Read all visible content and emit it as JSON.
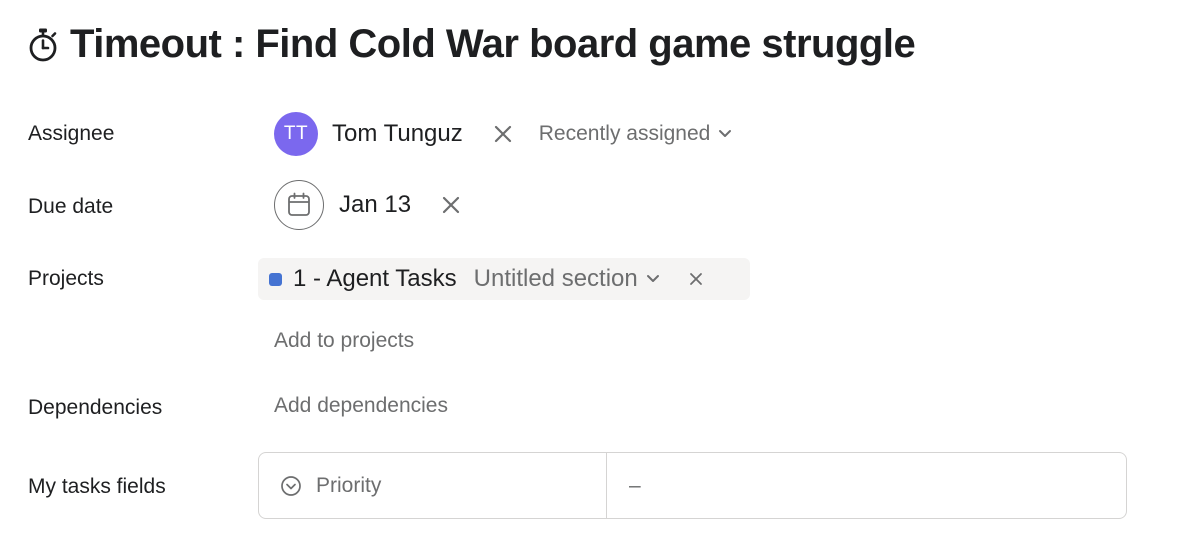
{
  "task": {
    "title": "Timeout : Find Cold War board game struggle",
    "title_icon": "stopwatch-icon"
  },
  "assignee": {
    "label": "Assignee",
    "avatar_initials": "TT",
    "avatar_color": "#7b68ee",
    "name": "Tom Tunguz",
    "dropdown_label": "Recently assigned"
  },
  "due_date": {
    "label": "Due date",
    "value": "Jan 13"
  },
  "projects": {
    "label": "Projects",
    "project_name": "1 - Agent Tasks",
    "project_color": "#4573d2",
    "section": "Untitled section",
    "add_link": "Add to projects"
  },
  "dependencies": {
    "label": "Dependencies",
    "add_link": "Add dependencies"
  },
  "my_tasks_fields": {
    "label": "My tasks fields",
    "field_name": "Priority",
    "field_value": "–"
  }
}
